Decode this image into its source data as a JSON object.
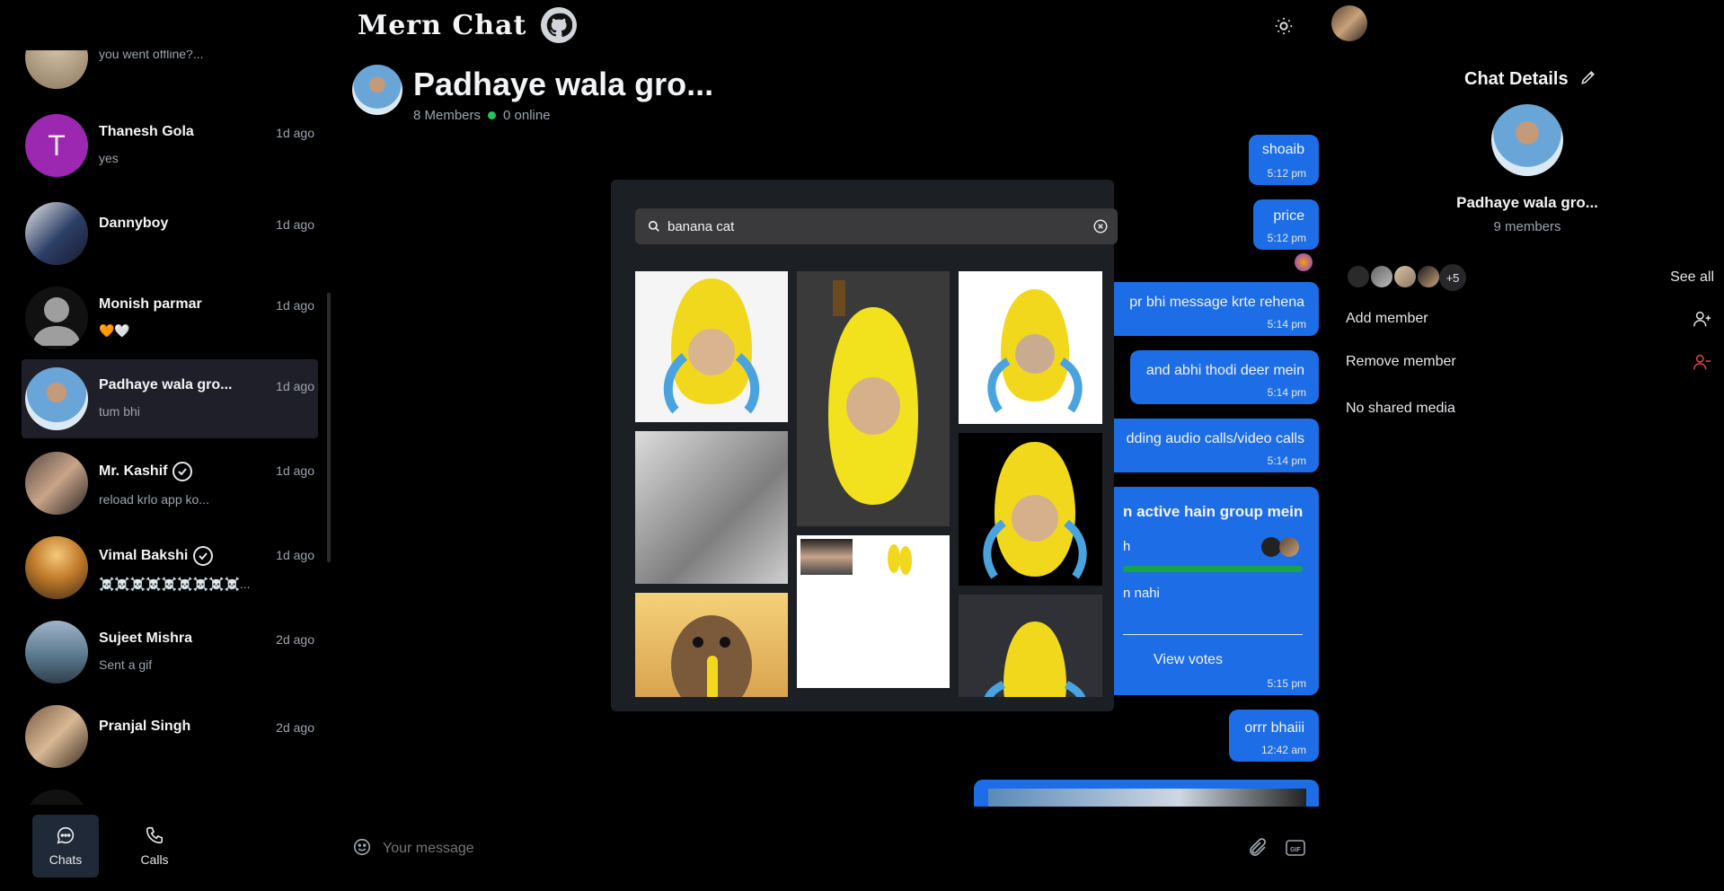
{
  "header": {
    "brand": "Mern Chat",
    "github_icon": "github-icon",
    "theme_icon": "sun-icon"
  },
  "sidebar": {
    "chats": [
      {
        "name": "",
        "message": "you went offline?...",
        "time": ""
      },
      {
        "name": "Thanesh Gola",
        "message": "yes",
        "time": "1d ago",
        "initial": "T"
      },
      {
        "name": "Dannyboy",
        "message": "",
        "time": "1d ago"
      },
      {
        "name": "Monish parmar",
        "message": "🧡🤍",
        "time": "1d ago"
      },
      {
        "name": "Padhaye wala gro...",
        "message": "tum bhi",
        "time": "1d ago"
      },
      {
        "name": "Mr. Kashif",
        "message": "reload krlo app ko...",
        "time": "1d ago"
      },
      {
        "name": "Vimal Bakshi",
        "message": "☠️☠️☠️☠️☠️☠️☠️☠️☠️...",
        "time": "1d ago"
      },
      {
        "name": "Sujeet Mishra",
        "message": "Sent a gif",
        "time": "2d ago"
      },
      {
        "name": "Pranjal Singh",
        "message": "",
        "time": "2d ago"
      }
    ]
  },
  "bottom_nav": {
    "chats": "Chats",
    "calls": "Calls"
  },
  "chat": {
    "title": "Padhaye wala gro...",
    "members": "8 Members",
    "online": "0 online",
    "messages": [
      {
        "text": "shoaib",
        "time": "5:12 pm"
      },
      {
        "text": "price",
        "time": "5:12 pm"
      },
      {
        "text": "pr bhi message krte rehena",
        "time": "5:14 pm"
      },
      {
        "text": "and abhi thodi deer mein",
        "time": "5:14 pm"
      },
      {
        "text": "dding audio calls/video calls",
        "time": "5:14 pm"
      },
      {
        "text": "orrr bhaiii",
        "time": "12:42 am"
      }
    ],
    "poll": {
      "question": "n active hain group mein",
      "option1": "h",
      "option2": "n nahi",
      "view_votes": "View votes",
      "time": "5:15 pm"
    },
    "input_placeholder": "Your message"
  },
  "gif_picker": {
    "search_value": "banana cat"
  },
  "details": {
    "title": "Chat Details",
    "group_name": "Padhaye wala gro...",
    "member_count": "9 members",
    "extra_members": "+5",
    "see_all": "See all",
    "add_member": "Add member",
    "remove_member": "Remove member",
    "no_media": "No shared media"
  },
  "colors": {
    "accent": "#1d6ee6",
    "online": "#22c55e",
    "danger": "#ef4444"
  }
}
